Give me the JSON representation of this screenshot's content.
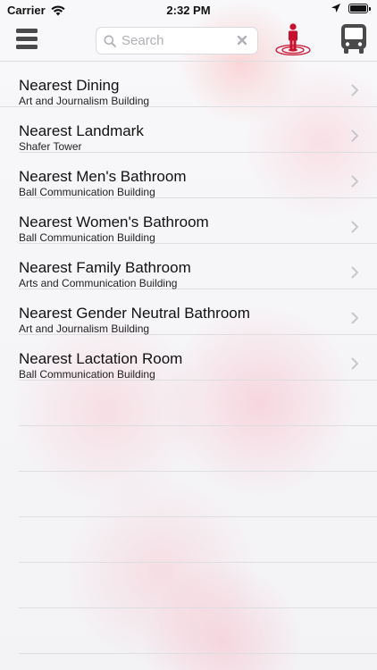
{
  "status_bar": {
    "carrier": "Carrier",
    "time": "2:32 PM",
    "icons": [
      "wifi-icon",
      "location-icon",
      "battery-icon"
    ]
  },
  "nav": {
    "menu_icon": "hamburger-menu-icon",
    "search": {
      "placeholder": "Search",
      "value": "",
      "clear_icon": "clear-icon"
    },
    "person_icon": "person-location-icon",
    "bus_icon": "bus-icon",
    "accent_color": "#c8102e",
    "icon_color": "#4a4a4a"
  },
  "locations": [
    {
      "title": "Nearest Dining",
      "subtitle": "Art and Journalism Building"
    },
    {
      "title": "Nearest Landmark",
      "subtitle": "Shafer Tower"
    },
    {
      "title": "Nearest Men's Bathroom",
      "subtitle": "Ball Communication Building"
    },
    {
      "title": "Nearest Women's Bathroom",
      "subtitle": "Ball Communication Building"
    },
    {
      "title": "Nearest Family Bathroom",
      "subtitle": "Arts and Communication Building"
    },
    {
      "title": "Nearest Gender Neutral Bathroom",
      "subtitle": "Art and Journalism Building"
    },
    {
      "title": "Nearest Lactation Room",
      "subtitle": "Ball Communication Building"
    }
  ]
}
